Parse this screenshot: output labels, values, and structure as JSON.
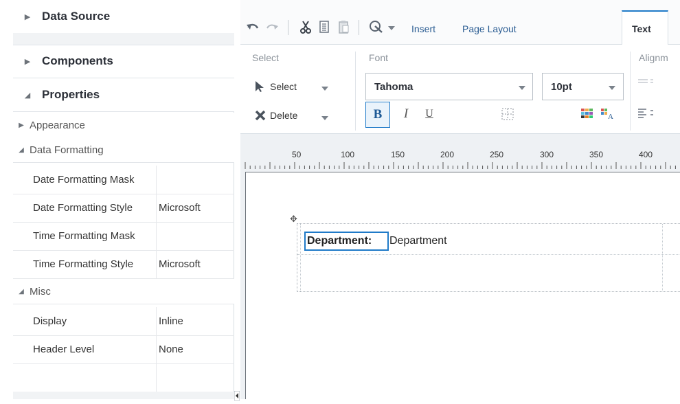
{
  "left_panel": {
    "accordions": [
      {
        "label": "Data Source",
        "expanded": false
      },
      {
        "label": "Components",
        "expanded": false
      },
      {
        "label": "Properties",
        "expanded": true
      }
    ],
    "sections": {
      "appearance": {
        "label": "Appearance",
        "expanded": false
      },
      "data_formatting": {
        "label": "Data Formatting",
        "expanded": true
      },
      "misc": {
        "label": "Misc",
        "expanded": true
      }
    },
    "data_formatting_rows": [
      {
        "name": "Date Formatting Mask",
        "value": ""
      },
      {
        "name": "Date Formatting Style",
        "value": "Microsoft"
      },
      {
        "name": "Time Formatting Mask",
        "value": ""
      },
      {
        "name": "Time Formatting Style",
        "value": "Microsoft"
      }
    ],
    "misc_rows": [
      {
        "name": "Display",
        "value": "Inline"
      },
      {
        "name": "Header Level",
        "value": "None"
      }
    ]
  },
  "toolbar": {
    "icons": [
      "undo-icon",
      "redo-icon",
      "cut-icon",
      "copy-icon",
      "paste-icon",
      "preview-icon"
    ],
    "tabs": [
      "Insert",
      "Page Layout",
      "Text"
    ],
    "active_tab": "Text"
  },
  "ribbon": {
    "select_group": {
      "label": "Select",
      "select_btn": "Select",
      "delete_btn": "Delete"
    },
    "font_group": {
      "label": "Font",
      "font_family": "Tahoma",
      "font_size": "10pt",
      "bold": "B",
      "italic": "I",
      "underline": "U"
    },
    "alignment_group": {
      "label": "Alignm"
    }
  },
  "ruler": {
    "marks": [
      "50",
      "100",
      "150",
      "200",
      "250",
      "300",
      "350",
      "400"
    ]
  },
  "canvas": {
    "label_text": "Department:",
    "value_text": "Department"
  },
  "colors": {
    "accent": "#1f7ac8",
    "link": "#2a5c92",
    "panel_border": "#d6dde3"
  }
}
